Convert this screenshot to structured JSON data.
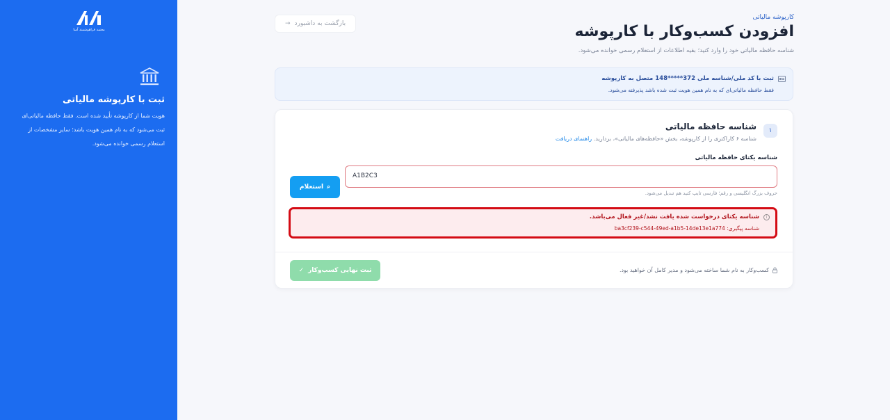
{
  "sidebar": {
    "logo_text": "معتمد فراهوشمند آسا",
    "title": "ثبت با کارپوشه مالیاتی",
    "description": "هویت شما از کارپوشه تأیید شده است. فقط حافظه مالیاتی‌ای ثبت می‌شود که به نام همین هویت باشد؛ سایر مشخصات از استعلام رسمی خوانده می‌شود."
  },
  "header": {
    "breadcrumb": "کارپوشه مالیاتی",
    "title": "افزودن کسب‌وکار با کارپوشه",
    "subtitle": "شناسه حافظه مالیاتی خود را وارد کنید؛ بقیه اطلاعات از استعلام رسمی خوانده می‌شود.",
    "back_label": "بازگشت به داشبورد"
  },
  "info_banner": {
    "title": "ثبت با کد ملی/شناسه ملی 372*****148 متصل به کارپوشه",
    "subtitle": "فقط حافظه مالیاتی‌ای که به نام همین هویت ثبت شده باشد پذیرفته می‌شود."
  },
  "form": {
    "step": "۱",
    "section_title": "شناسه حافظه مالیاتی",
    "section_desc": "شناسه ۶ کاراکتری را از کارپوشه، بخش «حافظه‌های مالیاتی»، بردارید.",
    "guide_link": "راهنمای دریافت",
    "field_label": "شناسه یکتای حافظه مالیاتی",
    "field_value": "A1B2C3",
    "field_hint": "حروف بزرگ انگلیسی و رقم؛ فارسی تایپ کنید هم تبدیل می‌شود.",
    "query_label": "استعلام",
    "error_title": "شناسه یکتای درخواست شده یافت نشد/غیر فعال می‌باشد.",
    "error_tracking": "شناسه پیگیری: ba3cf239-c544-49ed-a1b5-14de13e1a774",
    "note": "کسب‌وکار به نام شما ساخته می‌شود و مدیر کامل آن خواهید بود.",
    "submit_label": "ثبت نهایی کسب‌وکار"
  },
  "colors": {
    "sidebar_bg": "#1c6cf0",
    "primary_button": "#149ef2",
    "submit_disabled": "#8fdcab",
    "error_border": "#d40b14"
  }
}
